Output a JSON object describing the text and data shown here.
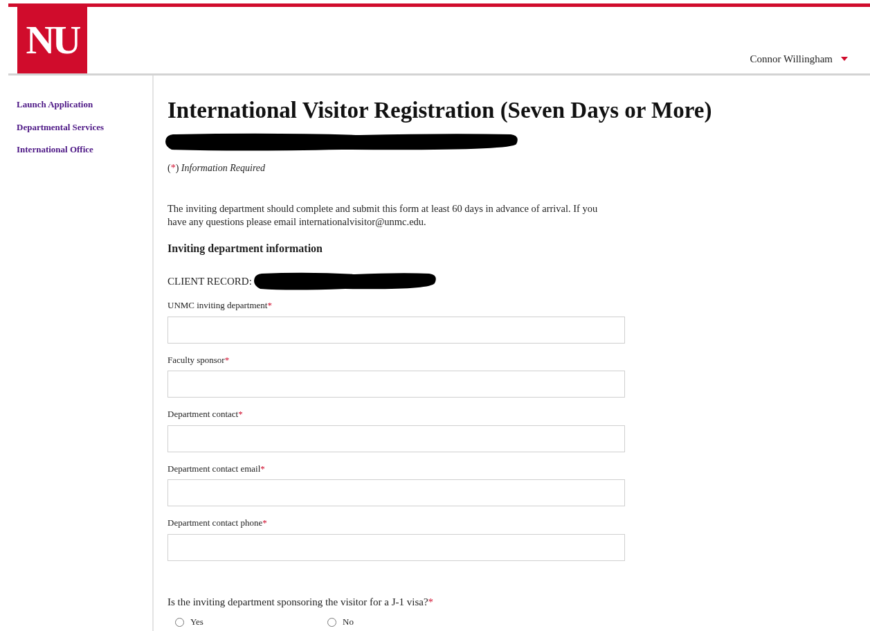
{
  "header": {
    "logo": "NU",
    "user": {
      "name": "Connor Willingham"
    }
  },
  "sidebar": {
    "items": [
      {
        "label": "Launch Application"
      },
      {
        "label": "Departmental Services"
      },
      {
        "label": "International Office"
      }
    ]
  },
  "form": {
    "title": "International Visitor Registration (Seven Days or More)",
    "legend": {
      "prefix": "(",
      "mark": "*",
      "suffix": ")",
      "text": "Information Required"
    },
    "intro": "The inviting department should complete and submit this form at least 60 days in advance of arrival. If you have any questions please email internationalvisitor@unmc.edu.",
    "section": "Inviting department information",
    "client_record": "CLIENT RECORD:",
    "fields": [
      {
        "label": "UNMC inviting department",
        "required_mark": "*"
      },
      {
        "label": "Faculty sponsor",
        "required_mark": "*"
      },
      {
        "label": "Department contact",
        "required_mark": "*"
      },
      {
        "label": "Department contact email",
        "required_mark": "*"
      },
      {
        "label": "Department contact phone",
        "required_mark": "*"
      }
    ],
    "question": {
      "label": "Is the inviting department sponsoring the visitor for a J-1 visa?",
      "required_mark": "*",
      "options": [
        {
          "label": "Yes",
          "selected": false
        },
        {
          "label": "No",
          "selected": false
        }
      ]
    }
  }
}
